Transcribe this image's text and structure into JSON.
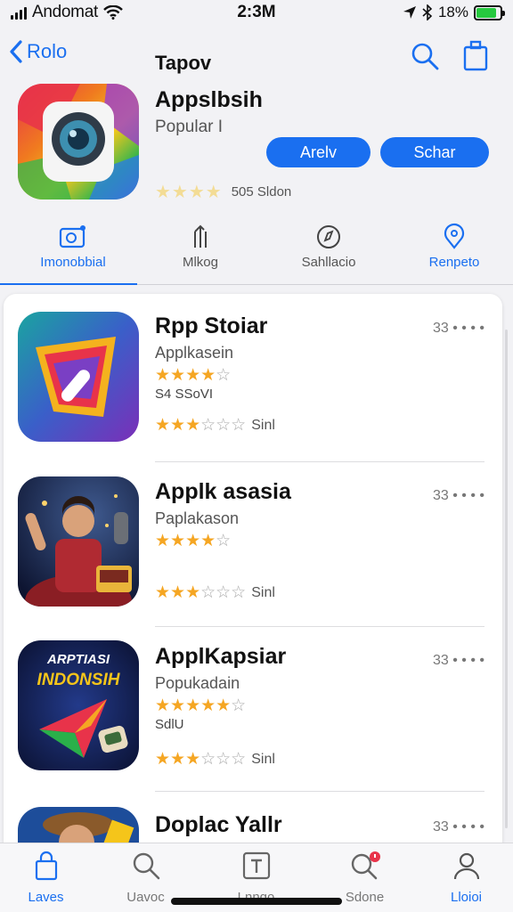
{
  "status": {
    "carrier": "Andomat",
    "time": "2:3M",
    "battery": "18%"
  },
  "nav": {
    "back_label": "Rolo",
    "title": "Tapov"
  },
  "hero": {
    "name": "Appslbsih",
    "subtitle": "Popular I",
    "button_a": "Arelv",
    "button_b": "Schar",
    "rating_text": "505 Sldon",
    "icon": "camera-lens-icon"
  },
  "tabs": [
    {
      "label": "Imonobbial",
      "icon": "camera-tab-icon"
    },
    {
      "label": "Mlkog",
      "icon": "share-tab-icon"
    },
    {
      "label": "Sahllacio",
      "icon": "compass-tab-icon"
    },
    {
      "label": "Renpeto",
      "icon": "pin-tab-icon"
    }
  ],
  "apps": [
    {
      "name": "Rpp Stoiar",
      "subtitle": "Applkasein",
      "extra": "S4 SSoVI",
      "size": "Sinl",
      "more": "33 • • • •",
      "stars_top": "4.5",
      "stars_bottom": "2.5"
    },
    {
      "name": "Applk asasia",
      "subtitle": "Paplakason",
      "extra": "",
      "size": "Sinl",
      "more": "33 • • • •",
      "stars_top": "4.5",
      "stars_bottom": "2.5"
    },
    {
      "name": "ApplKapsiar",
      "subtitle": "Popukadain",
      "extra": "SdlU",
      "size": "Sinl",
      "more": "33 • • • •",
      "stars_top": "4.5",
      "stars_bottom": "2.5",
      "icon_text_1": "ARPTIASI",
      "icon_text_2": "INDONSIH"
    },
    {
      "name": "Doplac Yallr",
      "subtitle": "",
      "extra": "",
      "size": "",
      "more": "33 • • • •"
    }
  ],
  "tabbar": [
    {
      "label": "Laves",
      "icon": "lock-tab-icon"
    },
    {
      "label": "Uavoc",
      "icon": "search-tab-icon"
    },
    {
      "label": "Lnngo",
      "icon": "text-tab-icon"
    },
    {
      "label": "Sdone",
      "icon": "search-badge-tab-icon"
    },
    {
      "label": "Lloioi",
      "icon": "person-tab-icon"
    }
  ],
  "colors": {
    "accent": "#1a6ff0",
    "star": "#f5a623"
  }
}
